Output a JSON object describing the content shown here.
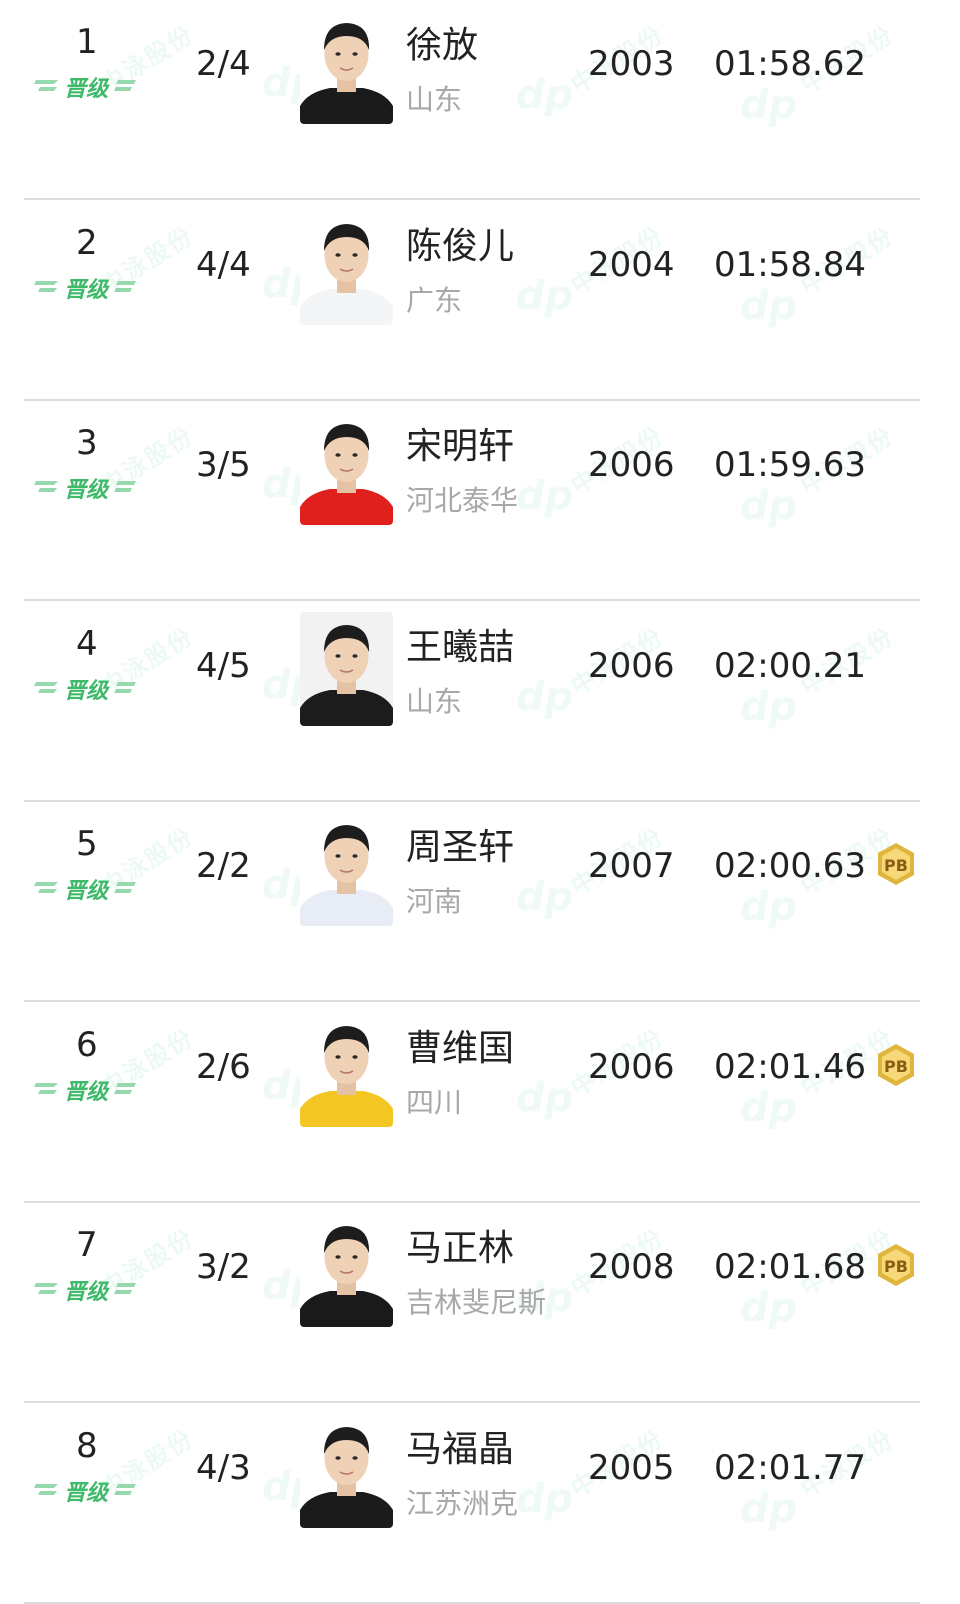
{
  "accent_green": "#3fb96a",
  "pb_gold": "#e0b53e",
  "rows": [
    {
      "rank": "1",
      "badge": "晋级",
      "heat": "2/4",
      "name": "徐放",
      "team": "山东",
      "year": "2003",
      "time": "01:58.62",
      "pb": false,
      "shirt": "#1b1b1b",
      "bg": "#ffffff"
    },
    {
      "rank": "2",
      "badge": "晋级",
      "heat": "4/4",
      "name": "陈俊儿",
      "team": "广东",
      "year": "2004",
      "time": "01:58.84",
      "pb": false,
      "shirt": "#f4f5f7",
      "bg": "#ffffff"
    },
    {
      "rank": "3",
      "badge": "晋级",
      "heat": "3/5",
      "name": "宋明轩",
      "team": "河北泰华",
      "year": "2006",
      "time": "01:59.63",
      "pb": false,
      "shirt": "#e0201d",
      "bg": "#ffffff"
    },
    {
      "rank": "4",
      "badge": "晋级",
      "heat": "4/5",
      "name": "王曦喆",
      "team": "山东",
      "year": "2006",
      "time": "02:00.21",
      "pb": false,
      "shirt": "#1c1c1c",
      "bg": "#f2f2f2"
    },
    {
      "rank": "5",
      "badge": "晋级",
      "heat": "2/2",
      "name": "周圣轩",
      "team": "河南",
      "year": "2007",
      "time": "02:00.63",
      "pb": true,
      "pb_label": "PB",
      "shirt": "#e8ecf4",
      "bg": "#ffffff"
    },
    {
      "rank": "6",
      "badge": "晋级",
      "heat": "2/6",
      "name": "曹维国",
      "team": "四川",
      "year": "2006",
      "time": "02:01.46",
      "pb": true,
      "pb_label": "PB",
      "shirt": "#f4c623",
      "bg": "#ffffff"
    },
    {
      "rank": "7",
      "badge": "晋级",
      "heat": "3/2",
      "name": "马正林",
      "team": "吉林斐尼斯",
      "year": "2008",
      "time": "02:01.68",
      "pb": true,
      "pb_label": "PB",
      "shirt": "#1a1a1a",
      "bg": "#ffffff"
    },
    {
      "rank": "8",
      "badge": "晋级",
      "heat": "4/3",
      "name": "马福晶",
      "team": "江苏洲克",
      "year": "2005",
      "time": "02:01.77",
      "pb": false,
      "shirt": "#1b1b1b",
      "bg": "#ffffff"
    }
  ]
}
